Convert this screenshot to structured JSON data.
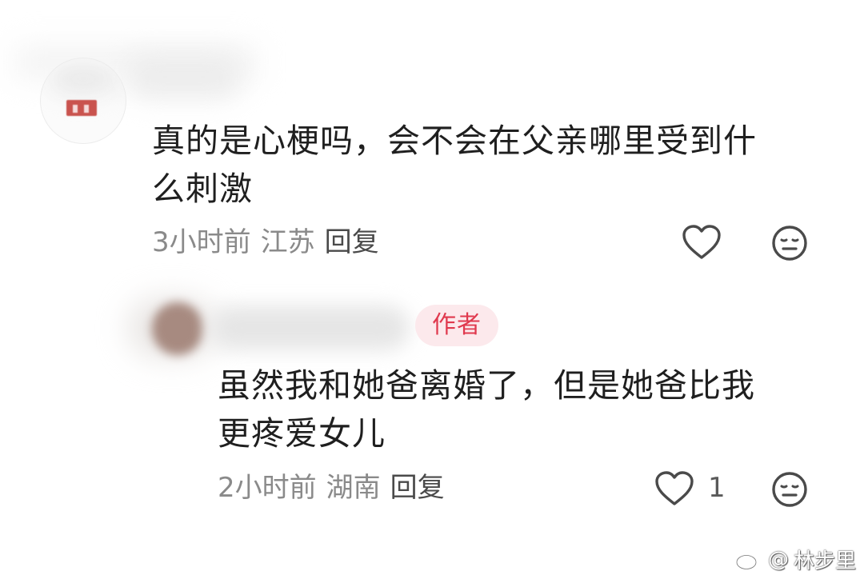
{
  "comments": [
    {
      "text": "真的是心梗吗，会不会在父亲哪里受到什\n么刺激",
      "time": "3小时前",
      "location": "江苏",
      "reply_label": "回复",
      "like_count": "",
      "avatar_icon": "blurred-avatar"
    },
    {
      "badge": "作者",
      "text": "虽然我和她爸离婚了，但是她爸比我\n更疼爱女儿",
      "time": "2小时前",
      "location": "湖南",
      "reply_label": "回复",
      "like_count": "1",
      "avatar_icon": "blurred-avatar"
    }
  ],
  "icons": {
    "like": "heart-outline-icon",
    "dislike": "neutral-face-icon"
  },
  "watermark": {
    "symbol": "@",
    "name": "林步里",
    "logo_icon": "weibo-logo-icon"
  },
  "colors": {
    "text": "#1f1f1f",
    "meta": "#8a8a8a",
    "badge_bg": "#fce9ec",
    "badge_text": "#e0394e",
    "icon": "#4a4a4a"
  }
}
